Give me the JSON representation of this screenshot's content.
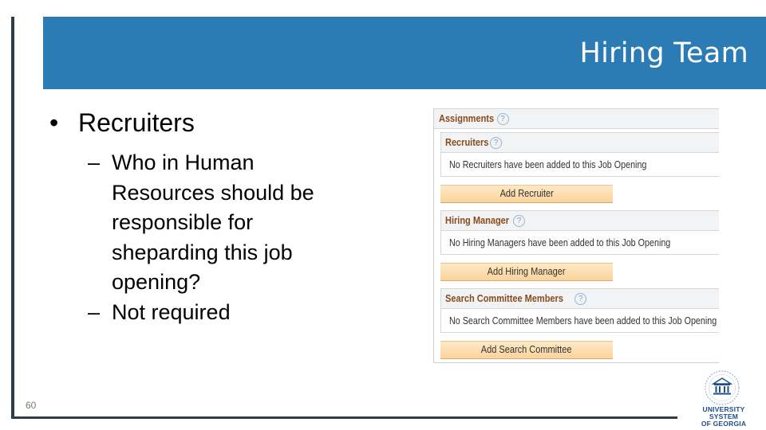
{
  "slide": {
    "title": "Hiring Team",
    "page_number": "60",
    "bullets": [
      {
        "text": "Recruiters",
        "marker": "•",
        "sub_bullets": [
          {
            "marker": "–",
            "lines": [
              "Who in Human",
              "Resources should be",
              "responsible for",
              "sheparding this job",
              "opening?"
            ]
          },
          {
            "marker": "–",
            "lines": [
              "Not required"
            ]
          }
        ]
      }
    ]
  },
  "assignments_panel": {
    "header": "Assignments",
    "help_icon": "?",
    "sections": [
      {
        "header": "Recruiters",
        "message": "No Recruiters have been added to this Job Opening",
        "button": "Add Recruiter"
      },
      {
        "header": "Hiring Manager",
        "message": "No Hiring Managers have been added to this Job Opening",
        "button": "Add Hiring Manager"
      },
      {
        "header": "Search Committee Members",
        "message": "No Search Committee Members have been added to this Job Opening",
        "button": "Add Search Committee"
      }
    ]
  },
  "logo": {
    "line1": "UNIVERSITY SYSTEM",
    "line2": "OF GEORGIA"
  },
  "colors": {
    "title_bar": "#2b7bb5",
    "section_header_text": "#8a4b1c",
    "button_fill": "#fbd49b",
    "rule": "#2e3d47"
  }
}
